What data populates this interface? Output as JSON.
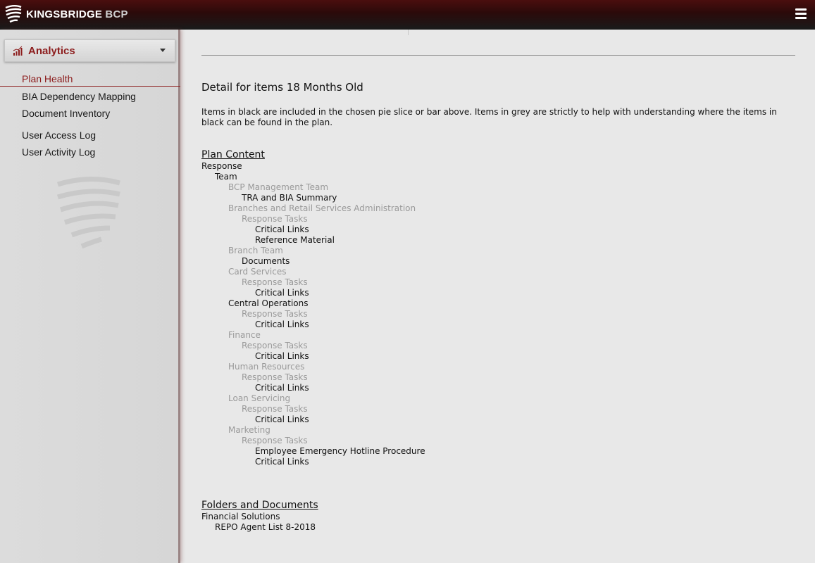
{
  "header": {
    "brand_main": "KINGSBRIDGE",
    "brand_sub": "BCP",
    "menu_icon": "hamburger-menu-icon"
  },
  "sidebar": {
    "section_label": "Analytics",
    "section_icon": "bar-chart-icon",
    "items": [
      {
        "label": "Plan Health"
      },
      {
        "label": "BIA Dependency Mapping"
      },
      {
        "label": "Document Inventory"
      },
      {
        "label": "User Access Log"
      },
      {
        "label": "User Activity Log"
      }
    ]
  },
  "main": {
    "detail_title": "Detail for items 18 Months Old",
    "note": "Items in black are included in the chosen pie slice or bar above. Items in grey are strictly to help with understanding where the items in black can be found in the plan.",
    "plan_content": {
      "title": "Plan Content",
      "rows": [
        {
          "text": "Response",
          "level": 0,
          "tone": "black"
        },
        {
          "text": "Team",
          "level": 1,
          "tone": "black"
        },
        {
          "text": "BCP Management Team",
          "level": 2,
          "tone": "grey"
        },
        {
          "text": "TRA and BIA Summary",
          "level": 3,
          "tone": "black"
        },
        {
          "text": "Branches and Retail Services Administration",
          "level": 2,
          "tone": "grey"
        },
        {
          "text": "Response Tasks",
          "level": 3,
          "tone": "grey"
        },
        {
          "text": "Critical Links",
          "level": 4,
          "tone": "black"
        },
        {
          "text": "Reference Material",
          "level": 4,
          "tone": "black"
        },
        {
          "text": "Branch Team",
          "level": 2,
          "tone": "grey"
        },
        {
          "text": "Documents",
          "level": 3,
          "tone": "black"
        },
        {
          "text": "Card Services",
          "level": 2,
          "tone": "grey"
        },
        {
          "text": "Response Tasks",
          "level": 3,
          "tone": "grey"
        },
        {
          "text": "Critical Links",
          "level": 4,
          "tone": "black"
        },
        {
          "text": "Central Operations",
          "level": 2,
          "tone": "black"
        },
        {
          "text": "Response Tasks",
          "level": 3,
          "tone": "grey"
        },
        {
          "text": "Critical Links",
          "level": 4,
          "tone": "black"
        },
        {
          "text": "Finance",
          "level": 2,
          "tone": "grey"
        },
        {
          "text": "Response Tasks",
          "level": 3,
          "tone": "grey"
        },
        {
          "text": "Critical Links",
          "level": 4,
          "tone": "black"
        },
        {
          "text": "Human Resources",
          "level": 2,
          "tone": "grey"
        },
        {
          "text": "Response Tasks",
          "level": 3,
          "tone": "grey"
        },
        {
          "text": "Critical Links",
          "level": 4,
          "tone": "black"
        },
        {
          "text": "Loan Servicing",
          "level": 2,
          "tone": "grey"
        },
        {
          "text": "Response Tasks",
          "level": 3,
          "tone": "grey"
        },
        {
          "text": "Critical Links",
          "level": 4,
          "tone": "black"
        },
        {
          "text": "Marketing",
          "level": 2,
          "tone": "grey"
        },
        {
          "text": "Response Tasks",
          "level": 3,
          "tone": "grey"
        },
        {
          "text": "Employee Emergency Hotline Procedure",
          "level": 4,
          "tone": "black"
        },
        {
          "text": "Critical Links",
          "level": 4,
          "tone": "black"
        }
      ]
    },
    "folders": {
      "title": "Folders and Documents",
      "rows": [
        {
          "text": "Financial Solutions",
          "level": 0,
          "tone": "black"
        },
        {
          "text": "REPO Agent List 8-2018",
          "level": 1,
          "tone": "black"
        }
      ]
    }
  },
  "colors": {
    "accent": "#8c1c1c",
    "grey_text": "#9a9a9a",
    "black_text": "#111111"
  }
}
